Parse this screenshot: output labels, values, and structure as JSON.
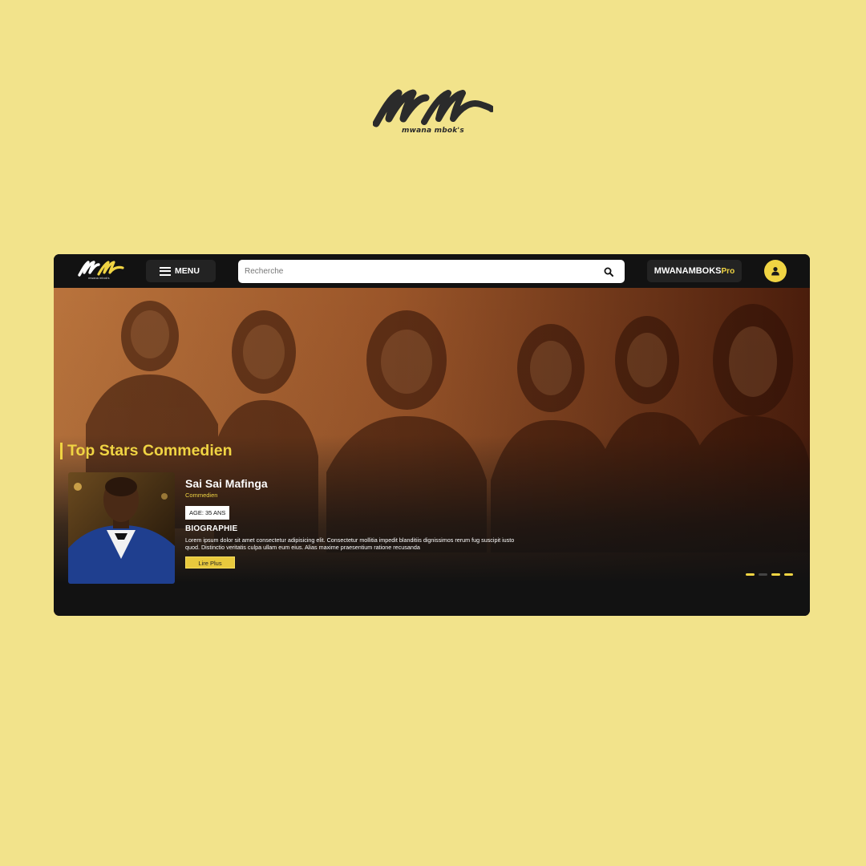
{
  "brand": {
    "caption": "mwana mbok's",
    "logo_name": "mm-logo"
  },
  "app": {
    "topbar": {
      "logo_caption": "mwana mbok's",
      "menu_label": "MENU",
      "search_placeholder": "Recherche",
      "search_icon": "search-icon",
      "pro_brand": "MWANAMBOKS",
      "pro_suffix": "Pro",
      "user_icon": "user-icon"
    },
    "hero": {
      "section_title": "Top Stars Commedien",
      "featured": {
        "name": "Sai Sai Mafinga",
        "role": "Commedien",
        "age": "AGE: 35 ANS",
        "bio_title": "BIOGRAPHIE",
        "bio": "Lorem ipsum dolor sit amet consectetur adipisicing elit. Consectetur mollitia impedit blanditiis dignissimos rerum fug suscipit iusto quod. Distinctio veritatis culpa ullam eum eius. Alias maxime praesentium ratione recusanda",
        "read_more": "Lire Plus"
      },
      "carousel": {
        "count": 4,
        "active": [
          0,
          2,
          3
        ]
      }
    }
  },
  "colors": {
    "background": "#f2e38b",
    "accent": "#f0d443",
    "window": "#121212",
    "hero_tint": "#8a4a22"
  }
}
